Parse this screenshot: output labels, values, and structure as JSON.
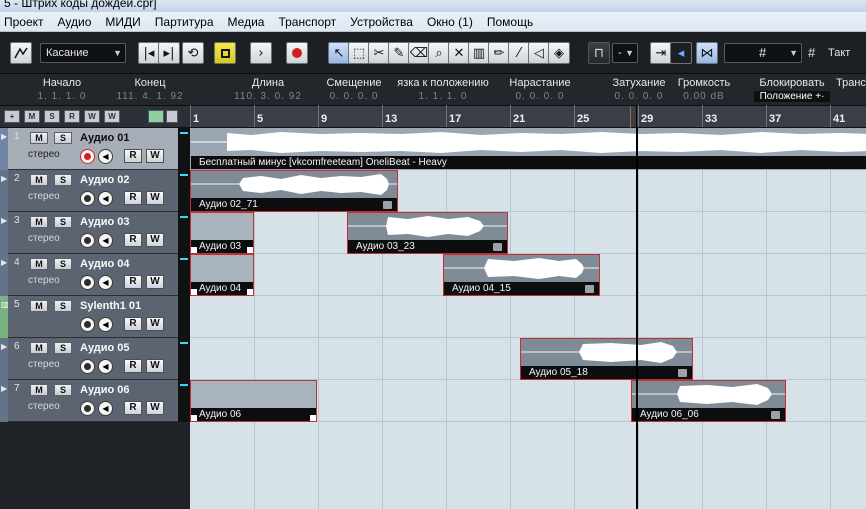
{
  "window": {
    "title": "5 - Штрих коды дождей.cpr]"
  },
  "menu": [
    "Проект",
    "Аудио",
    "МИДИ",
    "Партитура",
    "Медиа",
    "Транспорт",
    "Устройства",
    "Окно (1)",
    "Помощь"
  ],
  "toolbar": {
    "automation_mode": "Касание",
    "snap_value": "-",
    "grid_type": "Такт"
  },
  "infoline": {
    "columns": [
      {
        "label": "Начало",
        "value": "1. 1. 1. 0"
      },
      {
        "label": "Конец",
        "value": "111. 4. 1. 92"
      },
      {
        "label": "Длина",
        "value": "110. 3. 0. 92"
      },
      {
        "label": "Смещение",
        "value": "0. 0. 0. 0"
      },
      {
        "label": "язка к положению",
        "value": "1. 1. 1. 0"
      },
      {
        "label": "Нарастание",
        "value": "0. 0. 0. 0"
      },
      {
        "label": "Затухание",
        "value": "0. 0. 0. 0"
      },
      {
        "label": "Громкость",
        "value": "0.00 dB"
      },
      {
        "label": "Блокировать",
        "value": "Положение +·"
      },
      {
        "label": "Транс",
        "value": ""
      }
    ]
  },
  "ruler": {
    "bars": [
      "1",
      "5",
      "9",
      "13",
      "17",
      "21",
      "25",
      "29",
      "33",
      "37",
      "41"
    ]
  },
  "tracks": [
    {
      "num": "1",
      "name": "Аудио 01",
      "sub": "стерео",
      "selected": true,
      "record": true
    },
    {
      "num": "2",
      "name": "Аудио 02",
      "sub": "стерео"
    },
    {
      "num": "3",
      "name": "Аудио 03",
      "sub": "стерео"
    },
    {
      "num": "4",
      "name": "Аудио 04",
      "sub": "стерео"
    },
    {
      "num": "5",
      "name": "Sylenth1 01",
      "sub": ""
    },
    {
      "num": "6",
      "name": "Аудио 05",
      "sub": "стерео"
    },
    {
      "num": "7",
      "name": "Аудио 06",
      "sub": "стерео"
    }
  ],
  "buttons": {
    "mute": "M",
    "solo": "S",
    "read": "R",
    "write": "W"
  },
  "events": {
    "ev1": {
      "name": "Бесплатный минус [vkcomfreeteam] OneliBeat - Heavy"
    },
    "ev2": {
      "name": "Аудио 02_71"
    },
    "ev3a": {
      "name": "Аудио 03"
    },
    "ev3b": {
      "name": "Аудио 03_23"
    },
    "ev4a": {
      "name": "Аудио 04"
    },
    "ev4b": {
      "name": "Аудио 04_15"
    },
    "ev5": {
      "name": "Аудио 05_18"
    },
    "ev6a": {
      "name": "Аудио 06"
    },
    "ev6b": {
      "name": "Аудио 06_06"
    }
  },
  "colors": {
    "accent_meter": "#3ad6ff",
    "event_border": "#c23030",
    "record": "#d02020"
  }
}
